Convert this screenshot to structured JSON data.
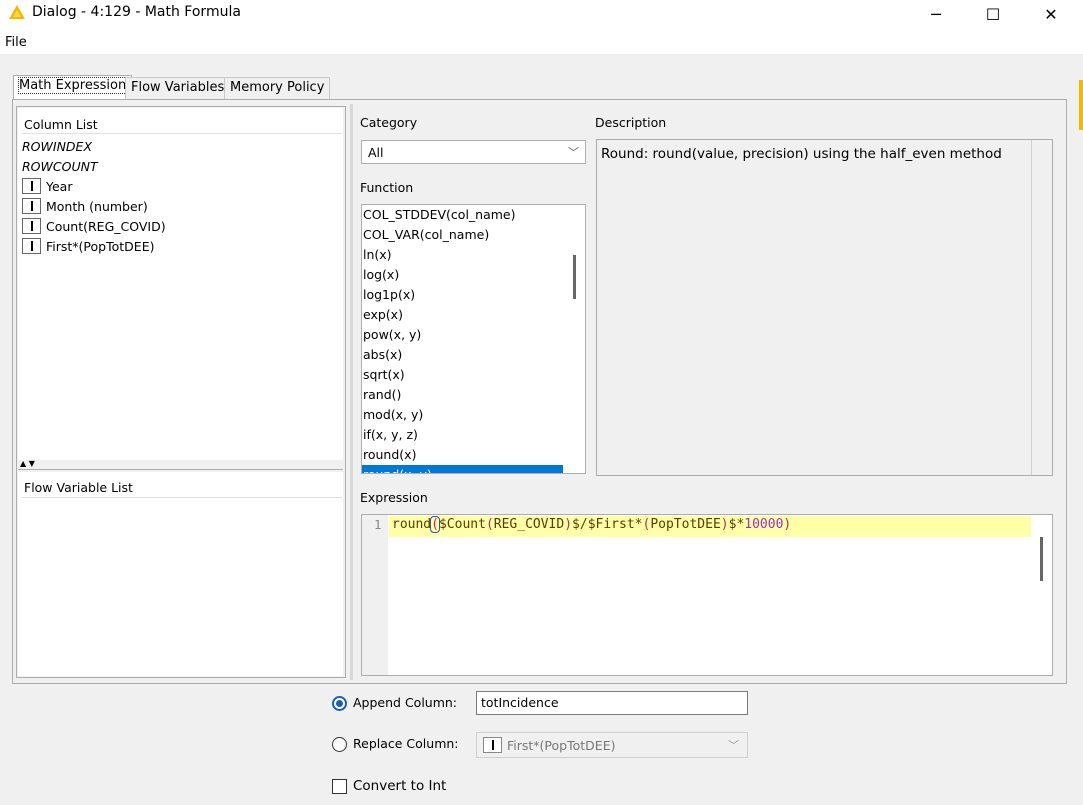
{
  "window": {
    "title": "Dialog - 4:129 - Math Formula",
    "minimize_glyph": "─",
    "maximize_glyph": "☐",
    "close_glyph": "✕"
  },
  "menu": {
    "file": "File"
  },
  "tabs": [
    {
      "label": "Math Expression",
      "active": true
    },
    {
      "label": "Flow Variables",
      "active": false
    },
    {
      "label": "Memory Policy",
      "active": false
    }
  ],
  "column_list": {
    "title": "Column List",
    "special": [
      "ROWINDEX",
      "ROWCOUNT"
    ],
    "columns": [
      "Year",
      "Month (number)",
      "Count(REG_COVID)",
      "First*(PopTotDEE)"
    ]
  },
  "flow_variable_list": {
    "title": "Flow Variable List"
  },
  "category": {
    "label": "Category",
    "value": "All"
  },
  "function": {
    "label": "Function",
    "items": [
      "COL_STDDEV(col_name)",
      "COL_VAR(col_name)",
      "ln(x)",
      "log(x)",
      "log1p(x)",
      "exp(x)",
      "pow(x, y)",
      "abs(x)",
      "sqrt(x)",
      "rand()",
      "mod(x, y)",
      "if(x, y, z)",
      "round(x)",
      "round(x, y)"
    ],
    "selected_index": 13
  },
  "description": {
    "label": "Description",
    "text": "Round: round(value, precision) using the half_even method"
  },
  "expression": {
    "label": "Expression",
    "line_number": "1",
    "tokens": {
      "fn": "round",
      "paren_open": "(",
      "col1": "$Count",
      "col1_paren_open": "(",
      "col1_inner": "REG_COVID",
      "col1_paren_close": ")",
      "col1_end": "$",
      "op_div": "/",
      "col2": "$First",
      "col2_star": "*",
      "col2_paren_open": "(",
      "col2_inner": "PopTotDEE",
      "col2_paren_close": ")",
      "col2_end": "$",
      "op_mul": "*",
      "number": "10000",
      "paren_close": ")"
    }
  },
  "output": {
    "append_label": "Append Column:",
    "append_value": "totIncidence",
    "append_selected": true,
    "replace_label": "Replace Column:",
    "replace_value": "First*(PopTotDEE)",
    "replace_selected": false,
    "convert_label": "Convert to Int",
    "convert_checked": false
  },
  "colors": {
    "accent": "#0078d7",
    "expr_highlight": "#ffffa8",
    "expr_number": "#9b30c8",
    "expr_paren": "#b03060",
    "expr_text": "#5a3a00"
  }
}
